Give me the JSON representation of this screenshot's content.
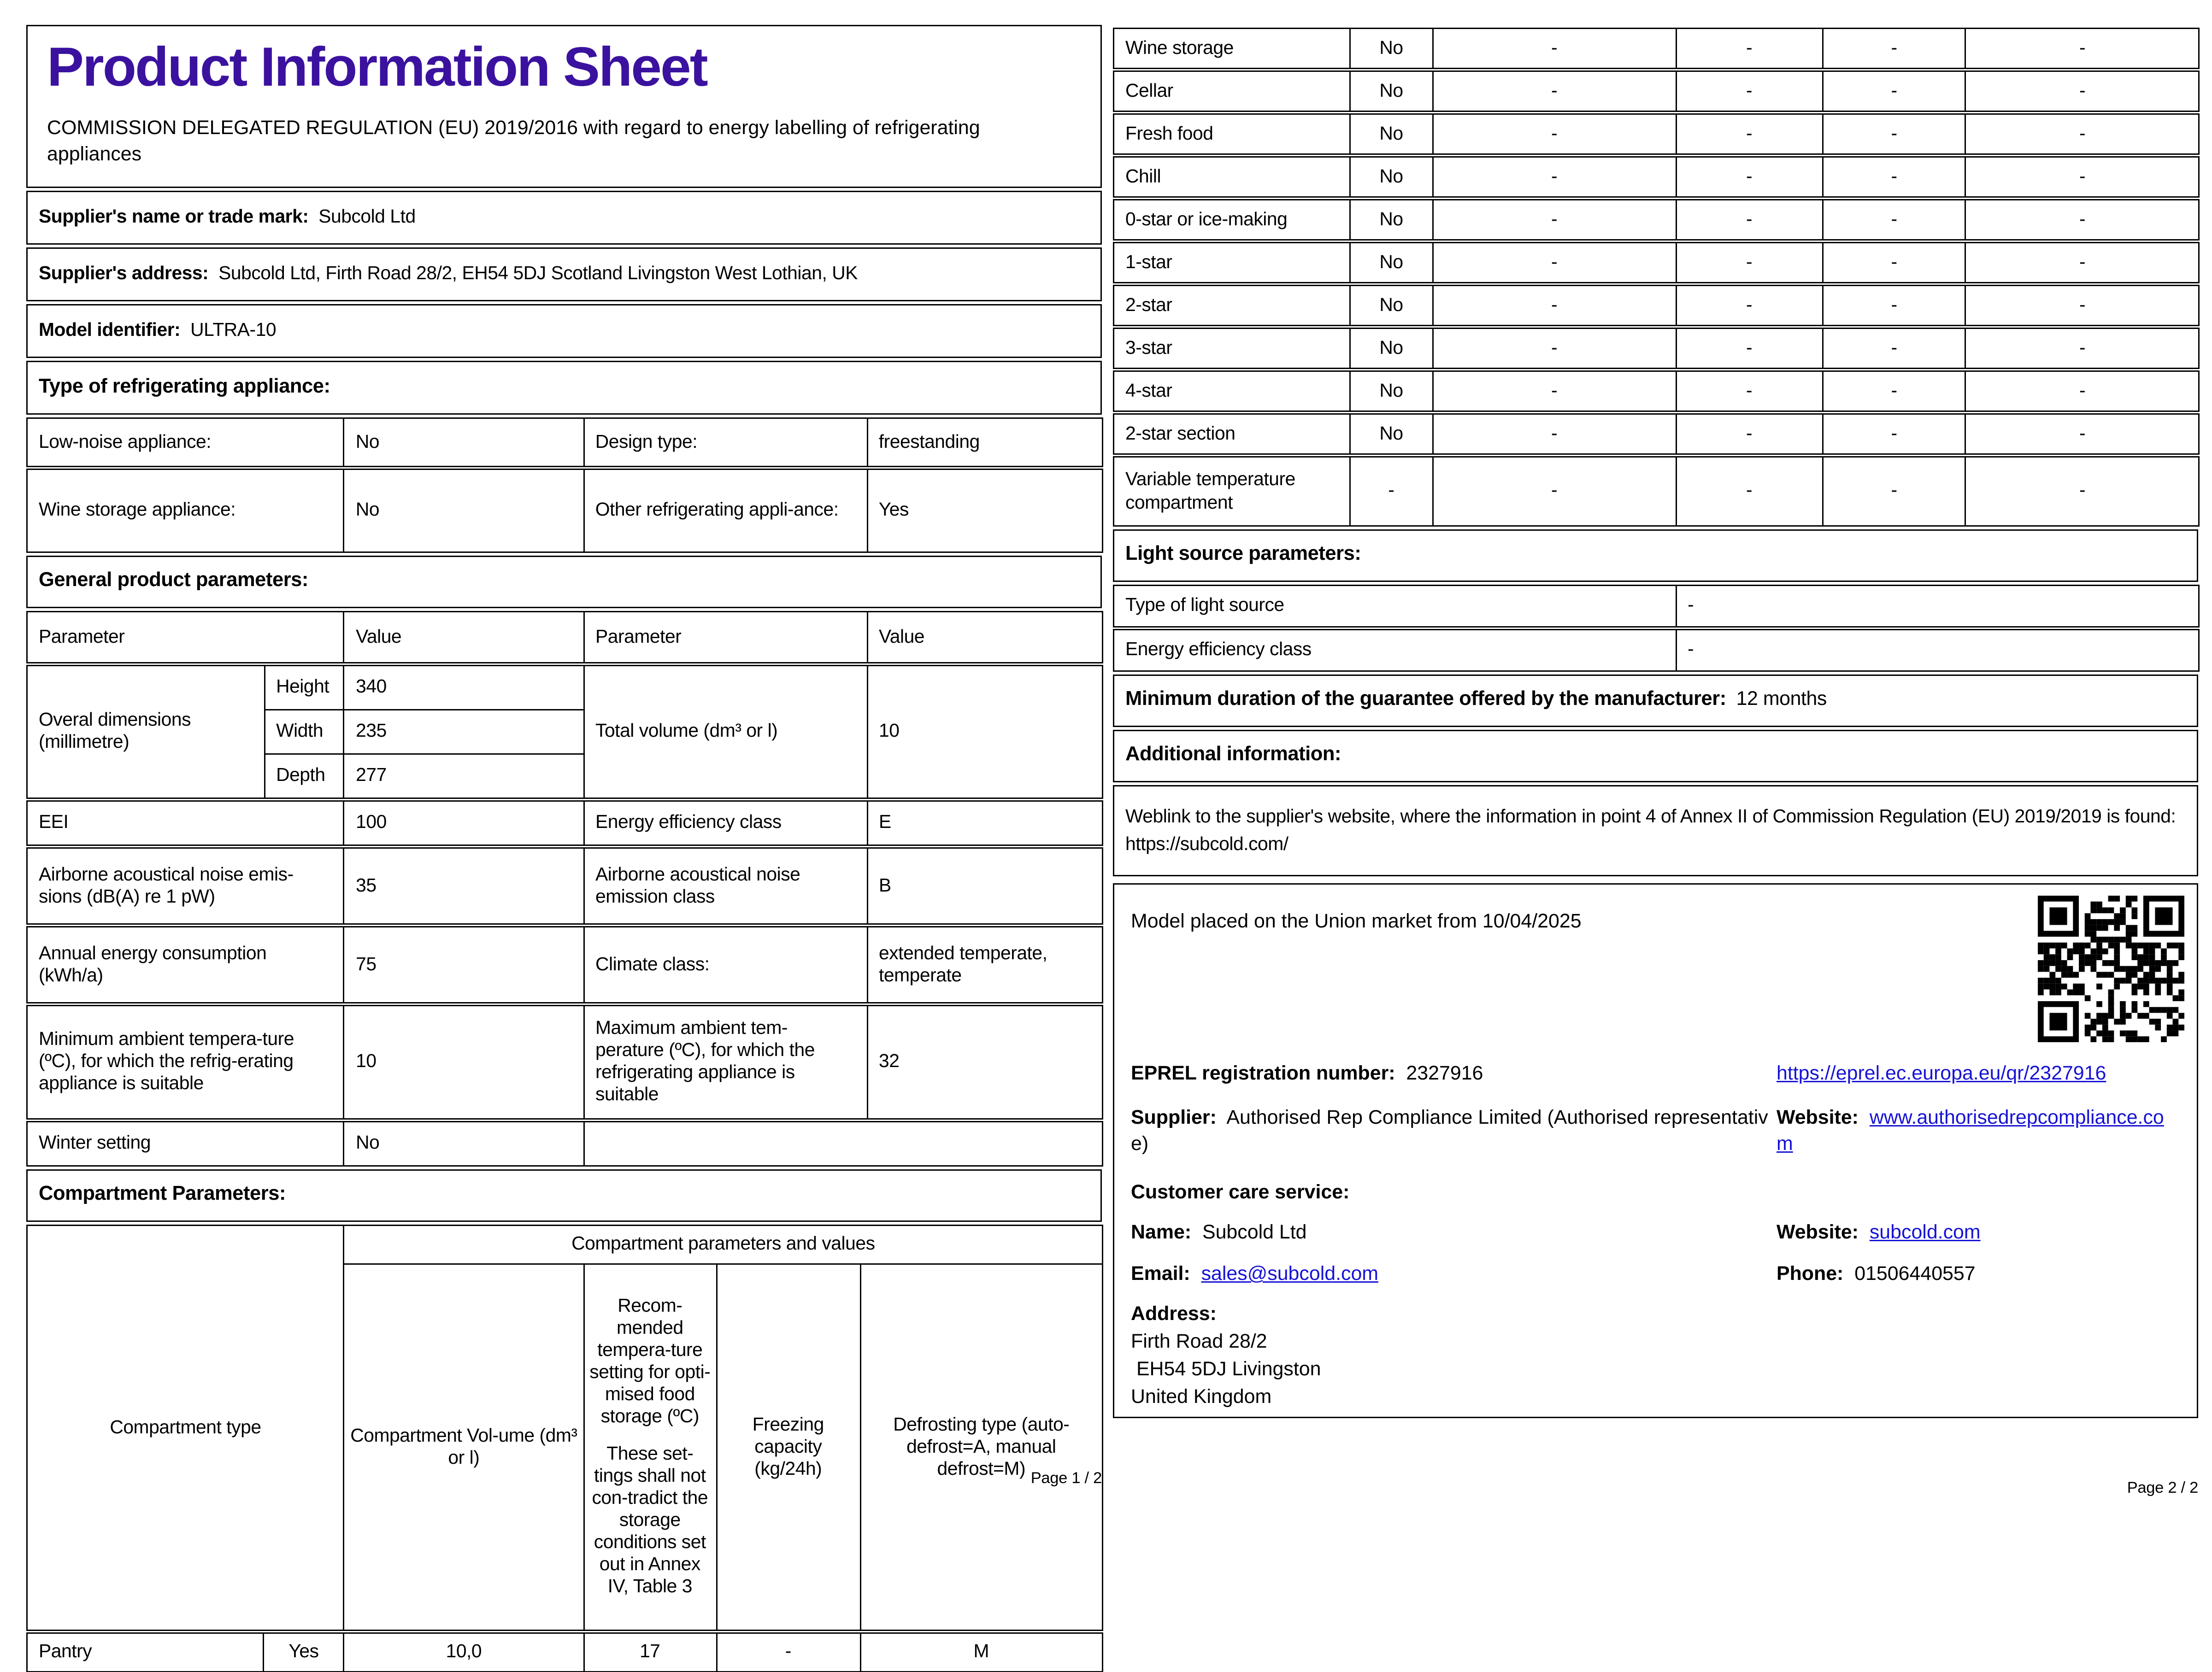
{
  "page1": {
    "title": "Product Information Sheet",
    "subtitle": "COMMISSION DELEGATED REGULATION (EU) 2019/2016 with regard to energy labelling of refrigerating appliances",
    "supplier_name_label": "Supplier's name or trade mark:",
    "supplier_name_value": "Subcold Ltd",
    "supplier_address_label": "Supplier's address:",
    "supplier_address_value": "Subcold Ltd, Firth Road 28/2, EH54 5DJ Scotland Livingston West Lothian, UK",
    "model_label": "Model identifier:",
    "model_value": "ULTRA-10",
    "type_heading": "Type of refrigerating appliance:",
    "low_noise_label": "Low-noise appliance:",
    "low_noise_value": "No",
    "design_label": "Design type:",
    "design_value": "freestanding",
    "wine_storage_label": "Wine storage appliance:",
    "wine_storage_value": "No",
    "other_appliance_label": "Other refrigerating appli-ance:",
    "other_appliance_value": "Yes",
    "general_heading": "General product parameters:",
    "col_parameter": "Parameter",
    "col_value": "Value",
    "dims_label": "Overal dimensions (millimetre)",
    "dim_height_label": "Height",
    "dim_height_value": "340",
    "dim_width_label": "Width",
    "dim_width_value": "235",
    "dim_depth_label": "Depth",
    "dim_depth_value": "277",
    "total_volume_label": "Total volume (dm³ or l)",
    "total_volume_value": "10",
    "eei_label": "EEI",
    "eei_value": "100",
    "eec_label": "Energy efficiency class",
    "eec_value": "E",
    "noise_label": "Airborne acoustical noise emis-sions (dB(A) re 1 pW)",
    "noise_value": "35",
    "noise_class_label": "Airborne acoustical noise emission class",
    "noise_class_value": "B",
    "energy_label": "Annual energy consumption (kWh/a)",
    "energy_value": "75",
    "climate_label": "Climate class:",
    "climate_value": "extended temperate, temperate",
    "min_temp_label": "Minimum ambient tempera-ture (ºC), for which the refrig-erating appliance is suitable",
    "min_temp_value": "10",
    "max_temp_label": "Maximum ambient tem-perature (ºC), for which the refrigerating appliance is suitable",
    "max_temp_value": "32",
    "winter_label": "Winter setting",
    "winter_value": "No",
    "compartment_heading": "Compartment Parameters:",
    "comp_type_header": "Compartment type",
    "comp_params_header": "Compartment parameters and values",
    "comp_volume_header": "Compartment Vol-ume (dm³ or l)",
    "comp_temp_header_main": "Recom-mended tempera-ture setting for opti-mised food storage (ºC)",
    "comp_temp_header_note": "These set-tings shall not con-tradict the storage conditions set out in Annex IV, Table 3",
    "comp_freezing_header": "Freezing capacity (kg/24h)",
    "comp_defrost_header": "Defrosting type (auto-defrost=A, manual defrost=M)",
    "comp_row": {
      "type": "Pantry",
      "present": "Yes",
      "volume": "10,0",
      "temp": "17",
      "freezing": "-",
      "defrost": "M"
    },
    "page_note": "Page 1 / 2"
  },
  "page2": {
    "dash": "-",
    "star_rows": [
      {
        "label": "Wine storage",
        "val": "No"
      },
      {
        "label": "Cellar",
        "val": "No"
      },
      {
        "label": "Fresh food",
        "val": "No"
      },
      {
        "label": "Chill",
        "val": "No"
      },
      {
        "label": "0-star or ice-making",
        "val": "No"
      },
      {
        "label": "1-star",
        "val": "No"
      },
      {
        "label": "2-star",
        "val": "No"
      },
      {
        "label": "3-star",
        "val": "No"
      },
      {
        "label": "4-star",
        "val": "No"
      },
      {
        "label": "2-star section",
        "val": "No"
      },
      {
        "label": "Variable temperature compartment",
        "val": "-"
      }
    ],
    "light_heading": "Light source parameters:",
    "light_type_label": "Type of light source",
    "light_type_value": "-",
    "light_class_label": "Energy efficiency class",
    "light_class_value": "-",
    "guarantee_label": "Minimum duration of the guarantee offered by the manufacturer:",
    "guarantee_value": "12 months",
    "additional_heading": "Additional information:",
    "weblink_label": "Weblink to the supplier's website, where the information in point 4 of Annex II of Commission Regulation (EU) 2019/2019 is found:",
    "weblink_url": "https://subcold.com/",
    "market_text": "Model placed on the Union market from 10/04/2025",
    "eprel_label": "EPREL registration number:",
    "eprel_value": "2327916",
    "eprel_link": "https://eprel.ec.europa.eu/qr/2327916",
    "supplier_label": "Supplier:",
    "supplier_value": "Authorised Rep Compliance Limited (Authorised representative)",
    "website_label": "Website:",
    "supplier_website": "www.authorisedrepcompliance.com",
    "care_heading": "Customer care service:",
    "name_label": "Name:",
    "name_value": "Subcold Ltd",
    "care_website": "subcold.com",
    "email_label": "Email:",
    "email_value": "sales@subcold.com",
    "phone_label": "Phone:",
    "phone_value": "01506440557",
    "address_label": "Address:",
    "address_line1": "Firth Road 28/2",
    "address_line2": " EH54 5DJ Livingston",
    "address_line3": "United Kingdom",
    "page_note": "Page 2 / 2"
  }
}
